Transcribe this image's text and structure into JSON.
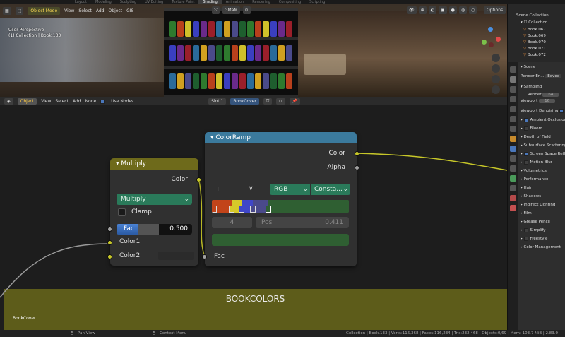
{
  "tabs": [
    "Layout",
    "Modeling",
    "Sculpting",
    "UV Editing",
    "Texture Paint",
    "Shading",
    "Animation",
    "Rendering",
    "Compositing",
    "Scripting"
  ],
  "active_tab": "Shading",
  "viewport": {
    "mode": "Object Mode",
    "menus": [
      "View",
      "Select",
      "Add",
      "Object",
      "GIS"
    ],
    "shading": "GMaM",
    "options": "Options",
    "perspective": "User Perspective",
    "collection_info": "(1) Collection | Book.133"
  },
  "node_header": {
    "editor": "Object",
    "menus": [
      "View",
      "Select",
      "Add",
      "Node"
    ],
    "use_nodes_label": "Use Nodes",
    "slot": "Slot 1",
    "material": "BookCover"
  },
  "nodes": {
    "multiply": {
      "title": "Multiply",
      "out_color": "Color",
      "blend_mode": "Multiply",
      "clamp_label": "Clamp",
      "fac_label": "Fac",
      "fac_value": "0.500",
      "fac_fraction": 0.5,
      "in_color1": "Color1",
      "in_color2": "Color2"
    },
    "colorramp": {
      "title": "ColorRamp",
      "out_color": "Color",
      "out_alpha": "Alpha",
      "plus": "+",
      "minus": "−",
      "dropdown": "∨",
      "color_mode": "RGB",
      "interpolation": "Consta...",
      "stop_index": "4",
      "pos_label": "Pos",
      "pos_value": "0.411",
      "in_fac": "Fac"
    }
  },
  "frame": {
    "label": "BOOKCOLORS",
    "small_label": "BookCover"
  },
  "outliner": {
    "title": "Scene Collection",
    "collection": "Collection",
    "items": [
      "Book.067",
      "Book.069",
      "Book.070",
      "Book.071",
      "Book.072"
    ]
  },
  "properties": {
    "scene_label": "Scene",
    "render_engine_label": "Render En...",
    "render_engine": "Eevee",
    "sampling": "Sampling",
    "render": "Render",
    "render_value": "64",
    "viewport": "Viewport",
    "viewport_value": "16",
    "viewport_denoising": "Viewport Denoising",
    "sections": [
      "Ambient Occlusion",
      "Bloom",
      "Depth of Field",
      "Subsurface Scattering",
      "Screen Space Reflections",
      "Motion Blur",
      "Volumetrics",
      "Performance",
      "Hair",
      "Shadows",
      "Indirect Lighting",
      "Film",
      "Grease Pencil",
      "Simplify",
      "Freestyle",
      "Color Management"
    ]
  },
  "statusbar": {
    "pan": "Pan View",
    "context": "Context Menu",
    "stats": "Collection | Book.133 | Verts:116,368 | Faces:116,234 | Tris:232,468 | Objects:0/69 | Mem: 103.7 MiB | 2.83.0"
  },
  "colors": {
    "accent": "#4a77bb",
    "multiply_header": "#6e6a1b",
    "colorramp_header": "#3b7a9d",
    "frame": "#5d5c1a",
    "socket_yellow": "#c7c729",
    "socket_gray": "#a1a1a1",
    "dropdown_green": "#2a7a5a"
  }
}
